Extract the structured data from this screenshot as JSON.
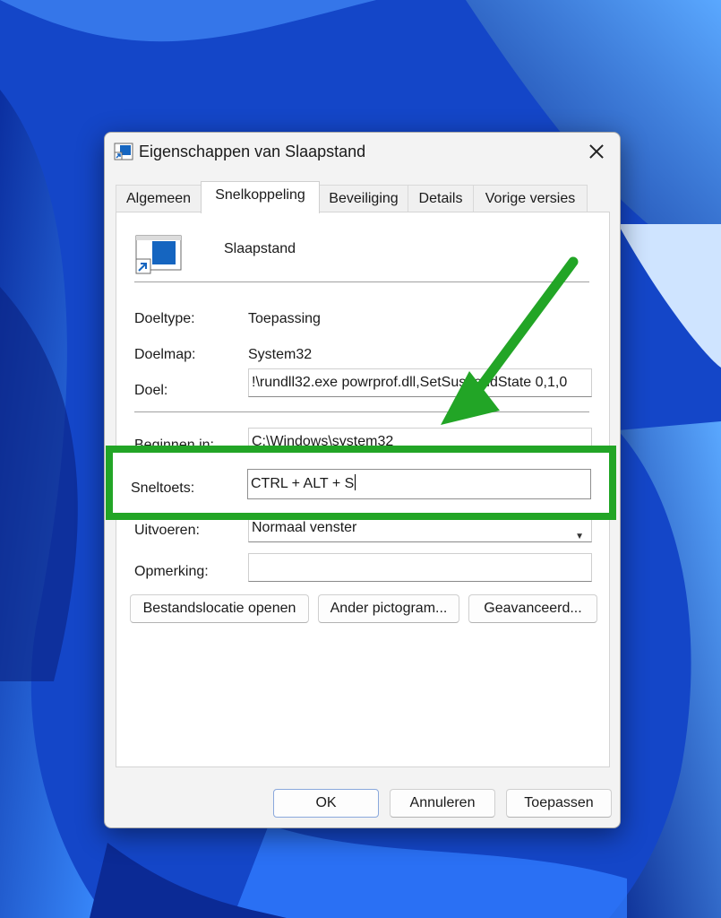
{
  "window": {
    "title": "Eigenschappen van Slaapstand"
  },
  "tabs": [
    {
      "label": "Algemeen"
    },
    {
      "label": "Snelkoppeling"
    },
    {
      "label": "Beveiliging"
    },
    {
      "label": "Details"
    },
    {
      "label": "Vorige versies"
    }
  ],
  "shortcut": {
    "name": "Slaapstand",
    "target_type_label": "Doeltype:",
    "target_type_value": "Toepassing",
    "target_folder_label": "Doelmap:",
    "target_folder_value": "System32",
    "target_label": "Doel:",
    "target_value": "!\\rundll32.exe powrprof.dll,SetSuspendState 0,1,0",
    "start_in_label": "Beginnen in:",
    "start_in_value": "C:\\Windows\\system32",
    "hotkey_label": "Sneltoets:",
    "hotkey_value": "CTRL + ALT + S",
    "run_label": "Uitvoeren:",
    "run_value": "Normaal venster",
    "comment_label": "Opmerking:",
    "comment_value": ""
  },
  "buttons": {
    "open_location": "Bestandslocatie openen",
    "change_icon": "Ander pictogram...",
    "advanced": "Geavanceerd...",
    "ok": "OK",
    "cancel": "Annuleren",
    "apply": "Toepassen"
  },
  "colors": {
    "highlight": "#22a526",
    "arrow": "#22a526",
    "accent": "#1f5fd0"
  }
}
